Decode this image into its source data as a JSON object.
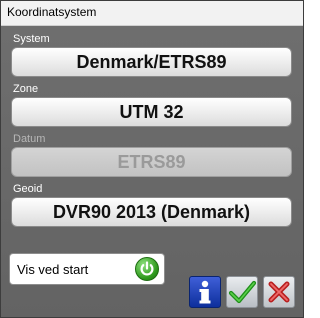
{
  "window": {
    "title": "Koordinatsystem"
  },
  "fields": [
    {
      "label": "System",
      "value": "Denmark/ETRS89",
      "enabled": true
    },
    {
      "label": "Zone",
      "value": "UTM 32",
      "enabled": true
    },
    {
      "label": "Datum",
      "value": "ETRS89",
      "enabled": false
    },
    {
      "label": "Geoid",
      "value": "DVR90 2013 (Denmark)",
      "enabled": true
    }
  ],
  "startup": {
    "label": "Vis ved start",
    "toggle_icon": "power-icon",
    "toggle_on": true
  },
  "actions": {
    "info_icon": "info-icon",
    "ok_icon": "checkmark-icon",
    "cancel_icon": "close-icon"
  },
  "colors": {
    "accent_green": "#2f9a1d",
    "info_blue": "#1a3fb8",
    "cancel_red": "#cc2a2a"
  }
}
